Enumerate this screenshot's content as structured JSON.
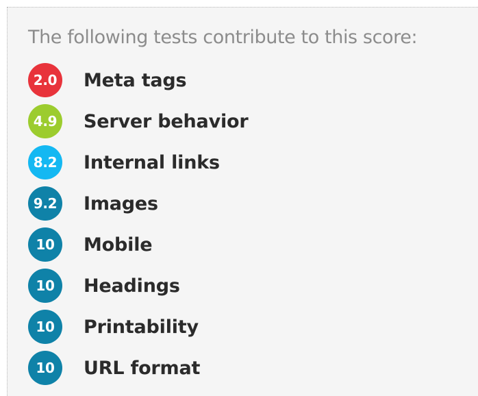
{
  "intro": "The following tests contribute to this score:",
  "tests": [
    {
      "score": "2.0",
      "label": "Meta tags",
      "color": "#e8333b"
    },
    {
      "score": "4.9",
      "label": "Server behavior",
      "color": "#9ccc2e"
    },
    {
      "score": "8.2",
      "label": "Internal links",
      "color": "#14b8f2"
    },
    {
      "score": "9.2",
      "label": "Images",
      "color": "#0f82a8"
    },
    {
      "score": "10",
      "label": "Mobile",
      "color": "#0f82a8"
    },
    {
      "score": "10",
      "label": "Headings",
      "color": "#0f82a8"
    },
    {
      "score": "10",
      "label": "Printability",
      "color": "#0f82a8"
    },
    {
      "score": "10",
      "label": "URL format",
      "color": "#0f82a8"
    }
  ]
}
